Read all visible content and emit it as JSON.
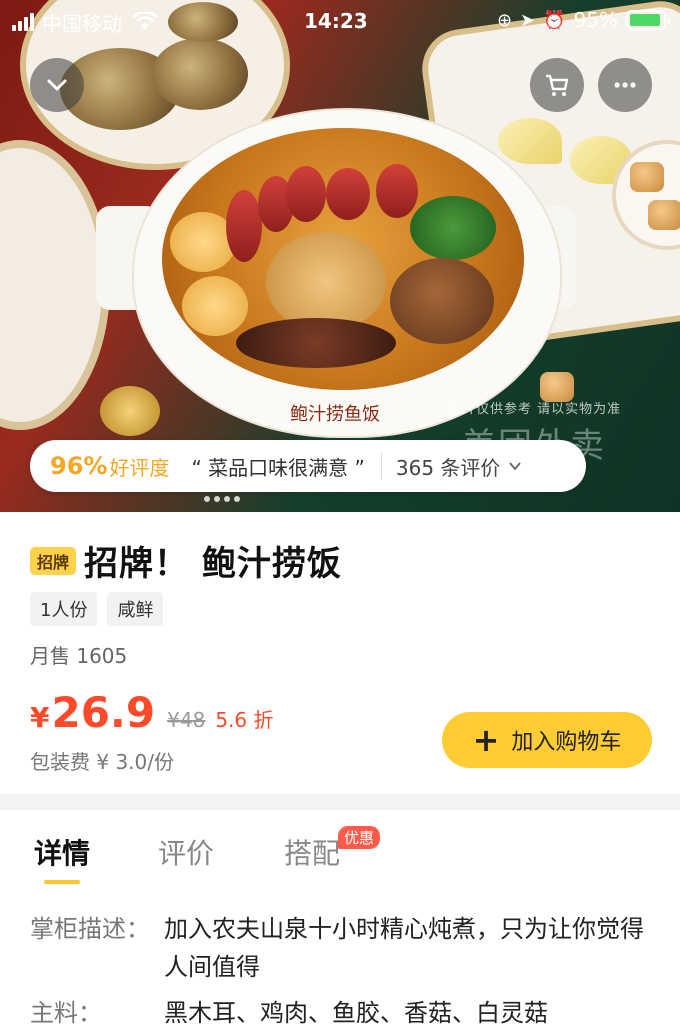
{
  "status_bar": {
    "carrier": "中国移动",
    "time": "14:23",
    "battery": "95%"
  },
  "nav": {
    "back_icon": "chevron-down-icon",
    "cart_icon": "cart-icon",
    "more_icon": "more-dots-icon"
  },
  "hero": {
    "pot_label": "鲍汁捞鱼饭",
    "watermark": "图片仅供参考 请以实物为准",
    "watermark_big": "美团外卖"
  },
  "rating": {
    "percent": "96%",
    "good_label": "好评度",
    "quote": "“ 菜品口味很满意 ”",
    "count": "365 条评价"
  },
  "product": {
    "badge": "招牌",
    "title": "招牌！ 鲍汁捞饭",
    "tags": [
      "1人份",
      "咸鲜"
    ],
    "monthly_sales": "月售 1605",
    "currency": "¥",
    "price": "26.9",
    "original_price": "¥48",
    "discount": "5.6 折",
    "packing_fee": "包装费 ¥ 3.0/份",
    "add_to_cart": "加入购物车"
  },
  "tabs": {
    "items": [
      {
        "label": "详情"
      },
      {
        "label": "评价"
      },
      {
        "label": "搭配"
      }
    ],
    "promo_badge": "优惠"
  },
  "details": {
    "description_key": "掌柜描述：",
    "description_value": "加入农夫山泉十小时精心炖煮，只为让你觉得人间值得",
    "ingredients_key": "主料：",
    "ingredients_value": "黑木耳、鸡肉、鱼胶、香菇、白灵菇"
  },
  "colors": {
    "accent_yellow": "#ffcc33",
    "price_red": "#ff4a2a",
    "rating_orange": "#f5a623"
  }
}
